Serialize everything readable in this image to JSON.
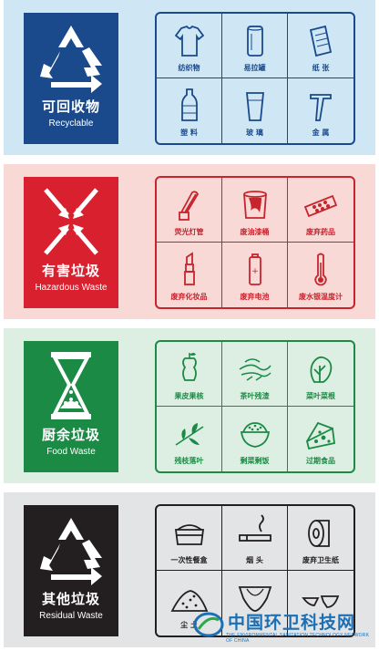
{
  "categories": [
    {
      "name_cn": "可回收物",
      "name_en": "Recyclable",
      "bg_color": "#cfe7f5",
      "badge_color": "#1a4a8c",
      "line_color": "#1a4a8c",
      "emblem_icon": "recycle-icon",
      "items": [
        {
          "label": "纺织物",
          "icon": "tshirt-icon"
        },
        {
          "label": "易拉罐",
          "icon": "can-icon"
        },
        {
          "label": "纸  张",
          "icon": "paper-roll-icon"
        },
        {
          "label": "塑  料",
          "icon": "plastic-bottle-icon"
        },
        {
          "label": "玻  璃",
          "icon": "glass-icon"
        },
        {
          "label": "金  属",
          "icon": "metal-tool-icon"
        }
      ]
    },
    {
      "name_cn": "有害垃圾",
      "name_en": "Hazardous Waste",
      "bg_color": "#f8d9d6",
      "badge_color": "#d9202f",
      "line_color": "#c8242e",
      "emblem_icon": "hazard-arrows-icon",
      "items": [
        {
          "label": "荧光灯管",
          "icon": "fluorescent-lamp-icon"
        },
        {
          "label": "废油漆桶",
          "icon": "paint-bucket-icon"
        },
        {
          "label": "废弃药品",
          "icon": "medicine-pills-icon"
        },
        {
          "label": "废弃化妆品",
          "icon": "lipstick-icon"
        },
        {
          "label": "废弃电池",
          "icon": "battery-icon"
        },
        {
          "label": "废水银温度计",
          "icon": "thermometer-icon"
        }
      ]
    },
    {
      "name_cn": "厨余垃圾",
      "name_en": "Food Waste",
      "bg_color": "#ddefe3",
      "badge_color": "#1b8a45",
      "line_color": "#1b8a45",
      "emblem_icon": "hourglass-icon",
      "items": [
        {
          "label": "果皮果核",
          "icon": "apple-core-icon"
        },
        {
          "label": "茶叶残渣",
          "icon": "tea-leaves-icon"
        },
        {
          "label": "菜叶菜根",
          "icon": "vegetable-icon"
        },
        {
          "label": "残枝落叶",
          "icon": "branch-leaves-icon"
        },
        {
          "label": "剩菜剩饭",
          "icon": "rice-bowl-icon"
        },
        {
          "label": "过期食品",
          "icon": "cheese-icon"
        }
      ]
    },
    {
      "name_cn": "其他垃圾",
      "name_en": "Residual Waste",
      "bg_color": "#e3e4e6",
      "badge_color": "#231f20",
      "line_color": "#231f20",
      "emblem_icon": "recycle-icon",
      "items": [
        {
          "label": "一次性餐盒",
          "icon": "lunch-box-icon"
        },
        {
          "label": "烟  头",
          "icon": "cigarette-icon"
        },
        {
          "label": "废弃卫生纸",
          "icon": "toilet-paper-icon"
        },
        {
          "label": "尘  土",
          "icon": "dust-pile-icon"
        },
        {
          "label": "",
          "icon": "diaper-icon"
        },
        {
          "label": "",
          "icon": "broken-bowl-icon"
        }
      ]
    }
  ],
  "watermark": {
    "text": "中国环卫科技网",
    "subtext": "THE ENVIRONMENTAL SANITATION TECHNOLOGY NETWORK OF CHINA",
    "color": "#1a6fb5"
  }
}
